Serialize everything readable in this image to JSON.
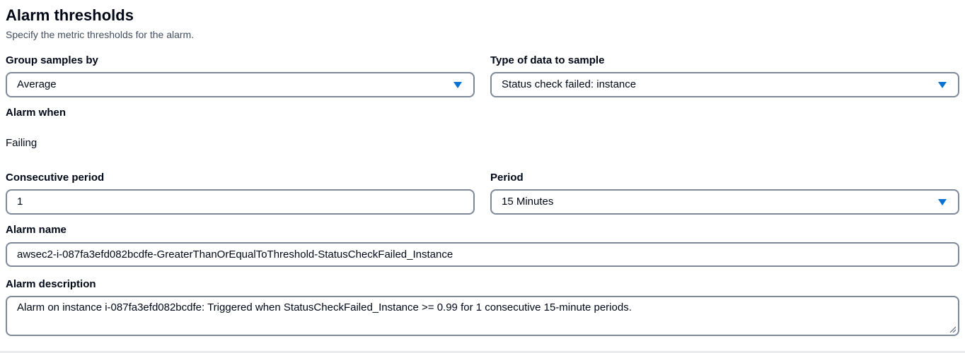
{
  "section": {
    "title": "Alarm thresholds",
    "description": "Specify the metric thresholds for the alarm."
  },
  "group_samples": {
    "label": "Group samples by",
    "value": "Average",
    "caret_icon": "caret-down-icon"
  },
  "data_type": {
    "label": "Type of data to sample",
    "value": "Status check failed: instance",
    "caret_icon": "caret-down-icon"
  },
  "alarm_when": {
    "label": "Alarm when",
    "value": "Failing"
  },
  "consecutive_period": {
    "label": "Consecutive period",
    "value": "1"
  },
  "period": {
    "label": "Period",
    "value": "15 Minutes",
    "caret_icon": "caret-down-icon"
  },
  "alarm_name": {
    "label": "Alarm name",
    "value": "awsec2-i-087fa3efd082bcdfe-GreaterThanOrEqualToThreshold-StatusCheckFailed_Instance"
  },
  "alarm_description": {
    "label": "Alarm description",
    "value": "Alarm on instance i-087fa3efd082bcdfe: Triggered when StatusCheckFailed_Instance >= 0.99 for 1 consecutive 15-minute periods.",
    "grip_icon": "resize-grip-icon"
  },
  "colors": {
    "accent": "#0972d3",
    "border": "#7d8998",
    "text": "#000716",
    "muted_text": "#414d5c"
  }
}
